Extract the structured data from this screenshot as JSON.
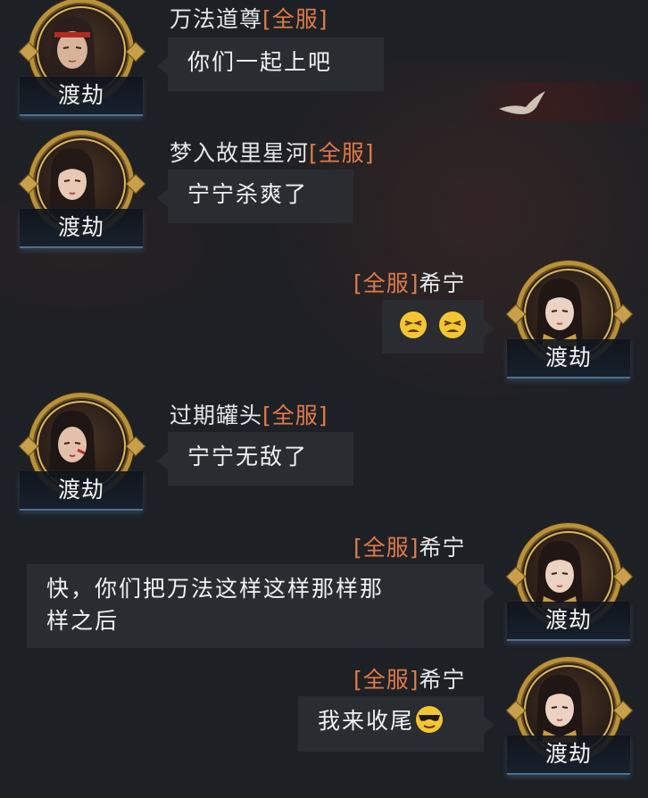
{
  "tag": "[全服]",
  "messages": [
    {
      "sender": "万法道尊",
      "side": "left",
      "text": "你们一起上吧",
      "avatar_label": "渡劫"
    },
    {
      "sender": "梦入故里星河",
      "side": "left",
      "text": "宁宁杀爽了",
      "avatar_label": "渡劫"
    },
    {
      "sender": "希宁",
      "side": "right",
      "text": "",
      "emojis": [
        "tired-face-emoji",
        "tired-face-emoji"
      ],
      "avatar_label": "渡劫"
    },
    {
      "sender": "过期罐头",
      "side": "left",
      "text": "宁宁无敌了",
      "avatar_label": "渡劫"
    },
    {
      "sender": "希宁",
      "side": "right",
      "text_line1": "快，你们把万法这样这样那样那",
      "text_line2": "样之后",
      "avatar_label": "渡劫"
    },
    {
      "sender": "希宁",
      "side": "right",
      "text": "我来收尾",
      "emojis": [
        "sunglasses-face-emoji"
      ],
      "avatar_label": "渡劫"
    }
  ],
  "colors": {
    "tag": "#e07a4a",
    "bubble": "#2a2e32",
    "frame": "#b8913a"
  }
}
